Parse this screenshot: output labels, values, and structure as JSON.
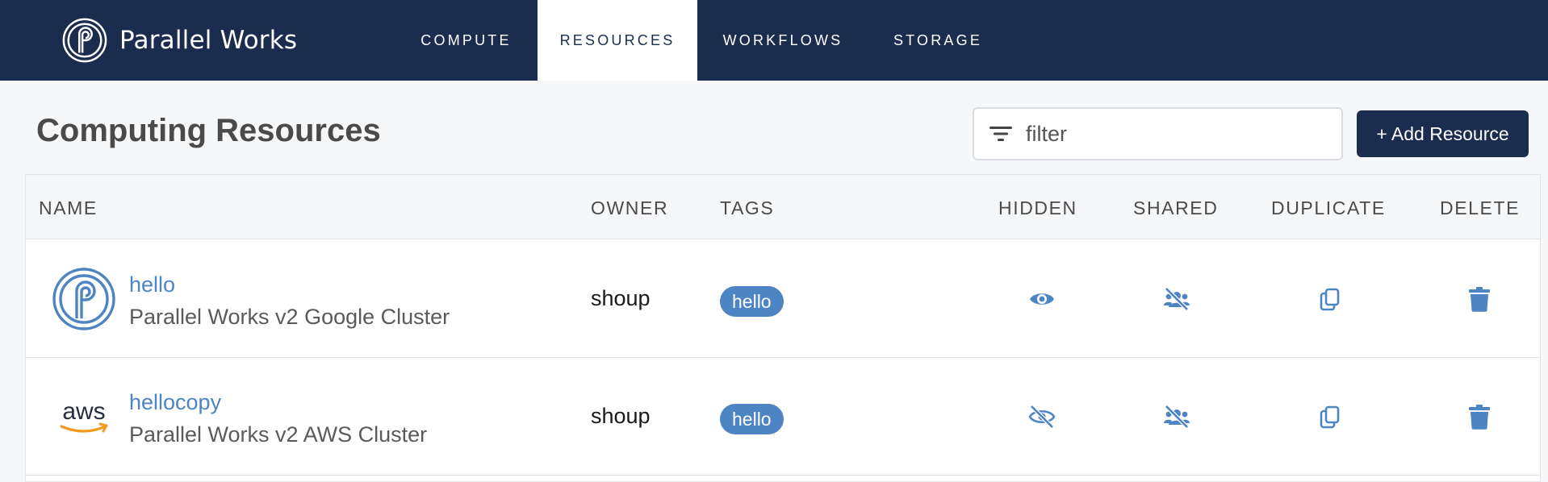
{
  "app": {
    "logo_text": "Parallel Works",
    "brand_color": "#1b2d4f",
    "accent_color": "#4d84c4"
  },
  "nav": {
    "tabs": [
      {
        "label": "COMPUTE",
        "active": false
      },
      {
        "label": "RESOURCES",
        "active": true
      },
      {
        "label": "WORKFLOWS",
        "active": false
      },
      {
        "label": "STORAGE",
        "active": false
      }
    ]
  },
  "page": {
    "title": "Computing Resources",
    "filter_placeholder": "filter",
    "filter_value": "",
    "add_button_label": "+ Add Resource"
  },
  "table": {
    "columns": [
      "NAME",
      "OWNER",
      "TAGS",
      "HIDDEN",
      "SHARED",
      "DUPLICATE",
      "DELETE"
    ],
    "rows": [
      {
        "icon": "parallel-works-logo-icon",
        "name": "hello",
        "type": "Parallel Works v2 Google Cluster",
        "owner": "shoup",
        "tag": "hello",
        "hidden_icon": "eye-icon",
        "shared_icon": "users-slash-icon",
        "duplicate_icon": "copy-icon",
        "delete_icon": "trash-icon"
      },
      {
        "icon": "aws-logo-icon",
        "logo_text": "aws",
        "name": "hellocopy",
        "type": "Parallel Works v2 AWS Cluster",
        "owner": "shoup",
        "tag": "hello",
        "hidden_icon": "eye-slash-icon",
        "shared_icon": "users-slash-icon",
        "duplicate_icon": "copy-icon",
        "delete_icon": "trash-icon"
      }
    ]
  }
}
